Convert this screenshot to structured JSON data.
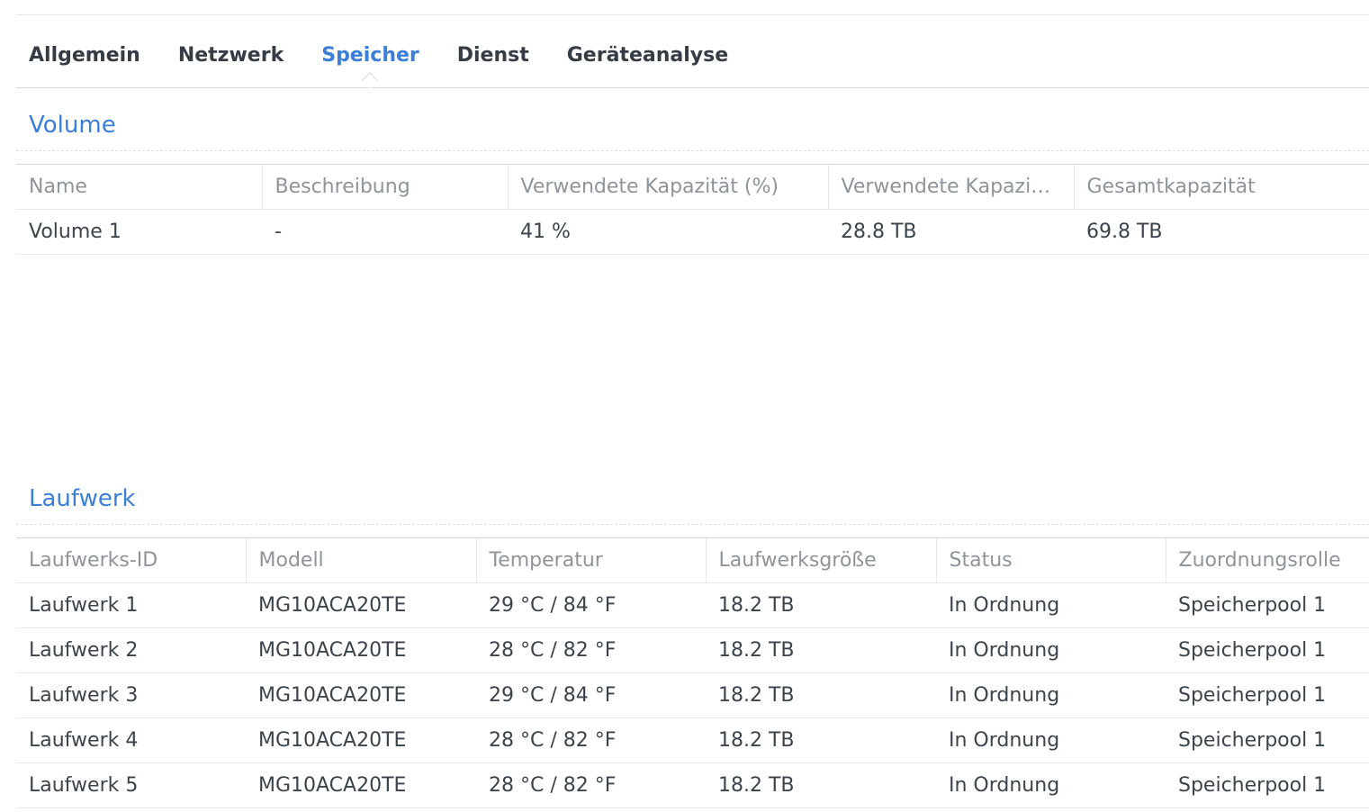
{
  "tabs": [
    {
      "label": "Allgemein",
      "active": false
    },
    {
      "label": "Netzwerk",
      "active": false
    },
    {
      "label": "Speicher",
      "active": true
    },
    {
      "label": "Dienst",
      "active": false
    },
    {
      "label": "Geräteanalyse",
      "active": false
    }
  ],
  "volume": {
    "title": "Volume",
    "headers": [
      "Name",
      "Beschreibung",
      "Verwendete Kapazität (%)",
      "Verwendete Kapazi…",
      "Gesamtkapazität"
    ],
    "rows": [
      {
        "name": "Volume 1",
        "description": "-",
        "used_percent": "41 %",
        "used": "28.8 TB",
        "total": "69.8 TB"
      }
    ]
  },
  "drives": {
    "title": "Laufwerk",
    "headers": [
      "Laufwerks-ID",
      "Modell",
      "Temperatur",
      "Laufwerksgröße",
      "Status",
      "Zuordnungsrolle"
    ],
    "rows": [
      {
        "id": "Laufwerk 1",
        "model": "MG10ACA20TE",
        "temp": "29 °C / 84 °F",
        "size": "18.2 TB",
        "status": "In Ordnung",
        "role": "Speicherpool 1"
      },
      {
        "id": "Laufwerk 2",
        "model": "MG10ACA20TE",
        "temp": "28 °C / 82 °F",
        "size": "18.2 TB",
        "status": "In Ordnung",
        "role": "Speicherpool 1"
      },
      {
        "id": "Laufwerk 3",
        "model": "MG10ACA20TE",
        "temp": "29 °C / 84 °F",
        "size": "18.2 TB",
        "status": "In Ordnung",
        "role": "Speicherpool 1"
      },
      {
        "id": "Laufwerk 4",
        "model": "MG10ACA20TE",
        "temp": "28 °C / 82 °F",
        "size": "18.2 TB",
        "status": "In Ordnung",
        "role": "Speicherpool 1"
      },
      {
        "id": "Laufwerk 5",
        "model": "MG10ACA20TE",
        "temp": "28 °C / 82 °F",
        "size": "18.2 TB",
        "status": "In Ordnung",
        "role": "Speicherpool 1"
      }
    ]
  },
  "colors": {
    "accent": "#3b7fd9",
    "status_ok": "#2e9c2a"
  }
}
